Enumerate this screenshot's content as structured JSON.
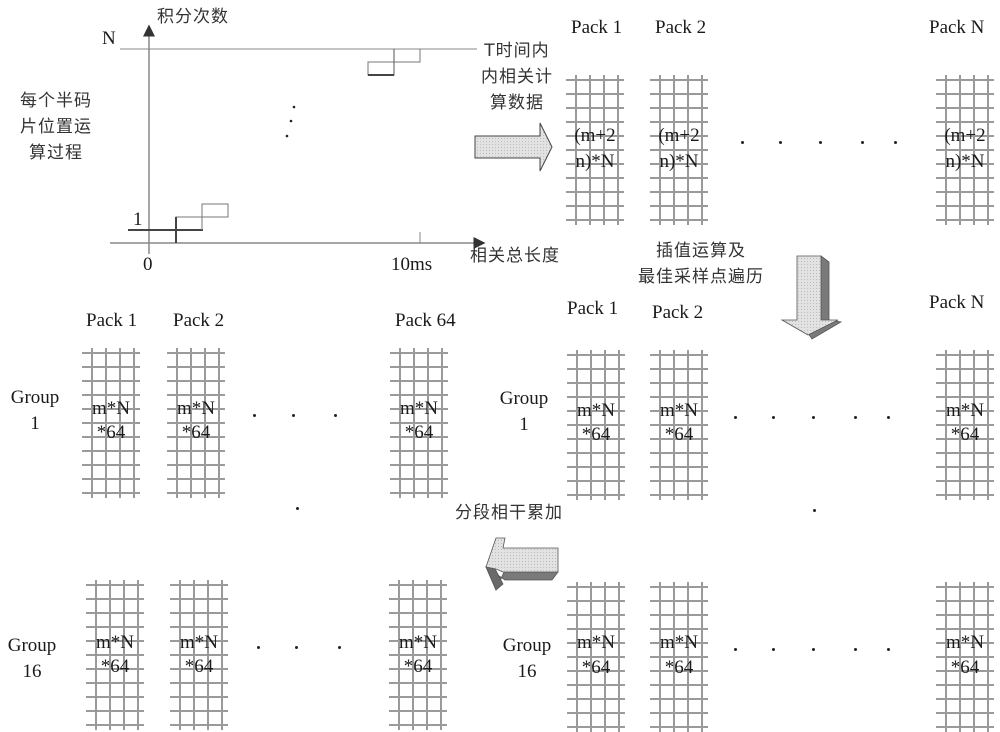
{
  "axes_panel": {
    "y_axis_label": "积分次数",
    "x_axis_label": "相关总长度",
    "y_tick_top": "N",
    "y_tick_bottom": "1",
    "x_tick_origin": "0",
    "x_tick_end": "10ms",
    "left_caption_lines": [
      "每个半码",
      "片位置运",
      "算过程"
    ],
    "right_caption_lines": [
      "T时间内",
      "内相关计",
      "算数据"
    ]
  },
  "top_row": {
    "packs": [
      {
        "label": "Pack 1",
        "content_lines": [
          "(m+2",
          "n)*N"
        ]
      },
      {
        "label": "Pack 2",
        "content_lines": [
          "(m+2",
          "n)*N"
        ]
      },
      {
        "label": "Pack N",
        "content_lines": [
          "(m+2",
          "n)*N"
        ]
      }
    ]
  },
  "down_arrow_caption_lines": [
    "插值运算及",
    "最佳采样点遍历"
  ],
  "left_arrow_caption": "分段相干累加",
  "left_panel": {
    "pack_labels": [
      "Pack 1",
      "Pack 2",
      "Pack 64"
    ],
    "groups": [
      {
        "label_lines": [
          "Group",
          "1"
        ],
        "cells": [
          [
            "m*N",
            "*64"
          ],
          [
            "m*N",
            "*64"
          ],
          [
            "m*N",
            "*64"
          ]
        ]
      },
      {
        "label_lines": [
          "Group",
          "16"
        ],
        "cells": [
          [
            "m*N",
            "*64"
          ],
          [
            "m*N",
            "*64"
          ],
          [
            "m*N",
            "*64"
          ]
        ]
      }
    ]
  },
  "right_panel": {
    "pack_labels": [
      "Pack 1",
      "Pack 2",
      "Pack N"
    ],
    "groups": [
      {
        "label_lines": [
          "Group",
          "1"
        ],
        "cells": [
          [
            "m*N",
            "*64"
          ],
          [
            "m*N",
            "*64"
          ],
          [
            "m*N",
            "*64"
          ]
        ]
      },
      {
        "label_lines": [
          "Group",
          "16"
        ],
        "cells": [
          [
            "m*N",
            "*64"
          ],
          [
            "m*N",
            "*64"
          ],
          [
            "m*N",
            "*64"
          ]
        ]
      }
    ]
  },
  "colors": {
    "grid_line": "#9a9a9a",
    "arrow_fill": "#d9d9d9",
    "arrow_shadow": "#7a7a7a",
    "text": "#1a1a1a"
  }
}
